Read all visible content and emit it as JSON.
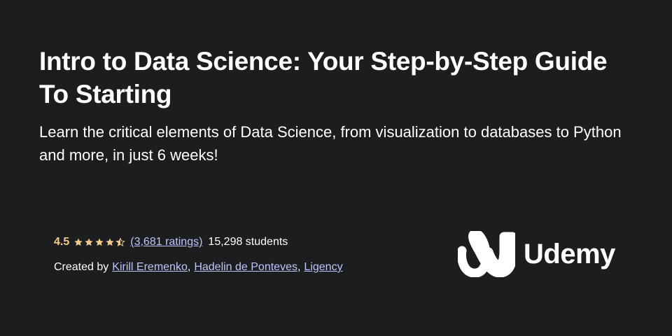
{
  "course": {
    "title": "Intro to Data Science: Your Step-by-Step Guide To Starting",
    "headline": "Learn the critical elements of Data Science, from visualization to databases to Python and more, in just 6 weeks!"
  },
  "rating": {
    "value": "4.5",
    "stars_filled": 4.5,
    "stars_total": 5,
    "star_color": "#f3ca8c",
    "ratings_count": "(3,681 ratings)",
    "students": "15,298 students"
  },
  "created_by": {
    "label": "Created by",
    "instructors": [
      "Kirill Eremenko",
      "Hadelin de Ponteves",
      "Ligency"
    ],
    "separator": ","
  },
  "brand": {
    "name": "Udemy",
    "icon": "udemy-logo-icon"
  },
  "colors": {
    "background": "#1c1d1f",
    "link": "#c0c4fc",
    "text": "#ffffff"
  }
}
